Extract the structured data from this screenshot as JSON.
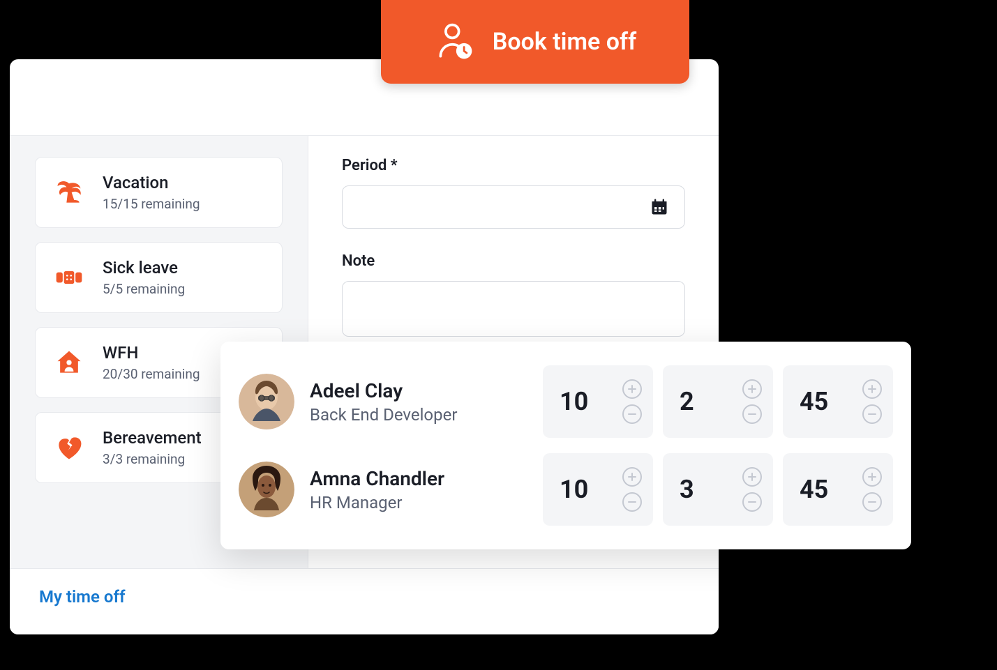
{
  "banner": {
    "label": "Book time off"
  },
  "leave_types": [
    {
      "title": "Vacation",
      "remaining": "15/15 remaining"
    },
    {
      "title": "Sick leave",
      "remaining": "5/5 remaining"
    },
    {
      "title": "WFH",
      "remaining": "20/30 remaining"
    },
    {
      "title": "Bereavement",
      "remaining": "3/3 remaining"
    }
  ],
  "form": {
    "period_label": "Period *",
    "note_label": "Note"
  },
  "footer": {
    "link": "My time off"
  },
  "people": [
    {
      "name": "Adeel Clay",
      "role": "Back End Developer",
      "stats": [
        "10",
        "2",
        "45"
      ]
    },
    {
      "name": "Amna Chandler",
      "role": "HR Manager",
      "stats": [
        "10",
        "3",
        "45"
      ]
    }
  ]
}
